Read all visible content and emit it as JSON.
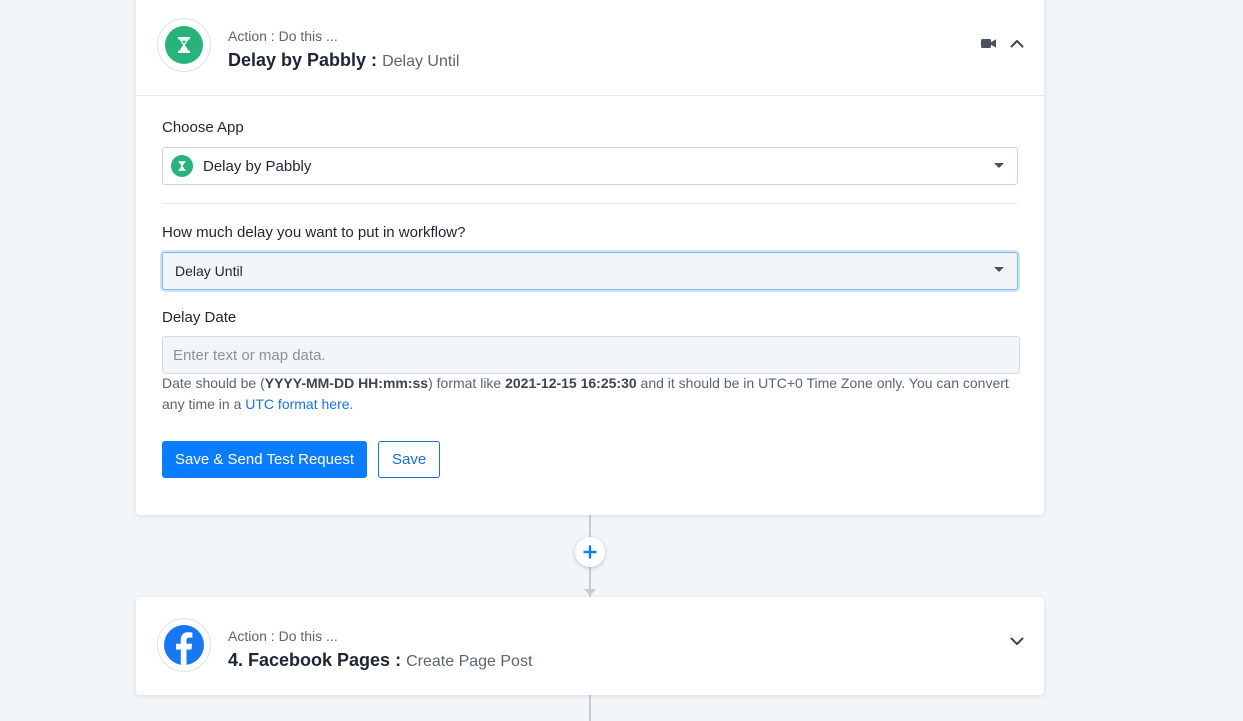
{
  "step_delay": {
    "subtitle": "Action : Do this ...",
    "app_name": "Delay by Pabbly :",
    "event_name": "Delay Until",
    "icons": [
      "video-icon",
      "chevron-up-icon"
    ],
    "brand_color": "#27b37a"
  },
  "form": {
    "choose_app_label": "Choose App",
    "choose_app_value": "Delay by Pabbly",
    "delay_question_label": "How much delay you want to put in workflow?",
    "delay_type_value": "Delay Until",
    "delay_date_label": "Delay Date",
    "delay_date_placeholder": "Enter text or map data.",
    "delay_date_value": "",
    "help": {
      "part1": "Date should be (",
      "format_bold": "YYYY-MM-DD HH:mm:ss",
      "part2": ") format like ",
      "example_bold": "2021-12-15 16:25:30",
      "part3": " and it should be in UTC+0 Time Zone only. You can convert any time in a ",
      "link": "UTC format here."
    },
    "save_send_label": "Save & Send Test Request",
    "save_label": "Save",
    "primary_color": "#0a7cff"
  },
  "step_facebook": {
    "subtitle": "Action : Do this ...",
    "app_name": "4. Facebook Pages :",
    "event_name": "Create Page Post",
    "icons": [
      "chevron-down-icon"
    ],
    "brand_color": "#1877f2"
  }
}
